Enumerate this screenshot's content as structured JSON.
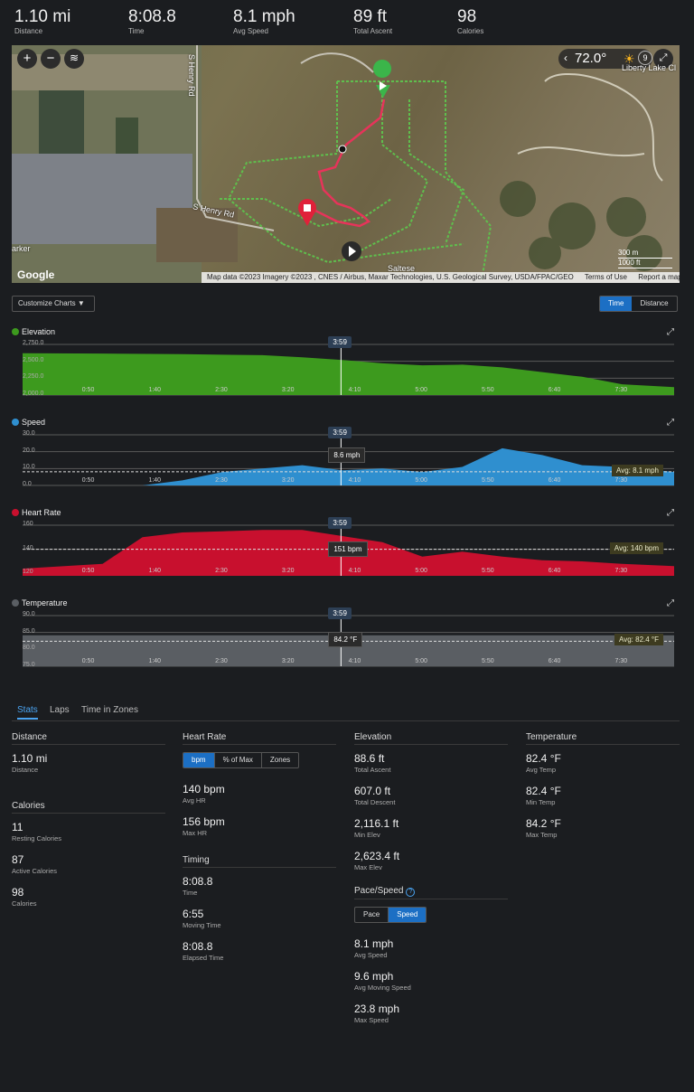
{
  "summary": [
    {
      "value": "1.10 mi",
      "label": "Distance"
    },
    {
      "value": "8:08.8",
      "label": "Time"
    },
    {
      "value": "8.1 mph",
      "label": "Avg Speed"
    },
    {
      "value": "89 ft",
      "label": "Total Ascent"
    },
    {
      "value": "98",
      "label": "Calories"
    }
  ],
  "map": {
    "zoom_in": "+",
    "zoom_out": "−",
    "layers_icon": "layers-icon",
    "weather_temp": "72.0°",
    "wind_speed": "9",
    "labels": [
      "S Henry Rd",
      "S Henry Rd",
      "Liberty Lake Cl",
      "Saltese",
      "arker"
    ],
    "scale_m": "300 m",
    "scale_ft": "1000 ft",
    "google": "Google",
    "attribution": "Map data ©2023 Imagery ©2023 , CNES / Airbus, Maxar Technologies, U.S. Geological Survey, USDA/FPAC/GEO",
    "terms": "Terms of Use",
    "report": "Report a map error"
  },
  "toolbar": {
    "customize": "Customize Charts",
    "toggle": [
      "Time",
      "Distance"
    ],
    "toggle_active": "Time"
  },
  "charts": [
    {
      "name": "Elevation",
      "color": "#3d9a1e",
      "yticks": [
        "2,750.0",
        "2,500.0",
        "2,250.0",
        "2,000.0"
      ],
      "cursor_time": "3:59",
      "cursor_value": "",
      "avg": ""
    },
    {
      "name": "Speed",
      "color": "#2f8fcf",
      "yticks": [
        "30.0",
        "20.0",
        "10.0",
        "0.0"
      ],
      "cursor_time": "3:59",
      "cursor_value": "8.6 mph",
      "avg": "Avg: 8.1 mph"
    },
    {
      "name": "Heart Rate",
      "color": "#c8102e",
      "yticks": [
        "160",
        "140",
        "120"
      ],
      "cursor_time": "3:59",
      "cursor_value": "151 bpm",
      "avg": "Avg: 140 bpm"
    },
    {
      "name": "Temperature",
      "color": "#5a5e63",
      "yticks": [
        "90.0",
        "85.0",
        "80.0",
        "75.0"
      ],
      "cursor_time": "3:59",
      "cursor_value": "84.2 °F",
      "avg": "Avg: 82.4 °F"
    }
  ],
  "xticks": [
    "0:50",
    "1:40",
    "2:30",
    "3:20",
    "4:10",
    "5:00",
    "5:50",
    "6:40",
    "7:30"
  ],
  "chart_data": [
    {
      "type": "area",
      "title": "Elevation",
      "x_unit": "elapsed time (min)",
      "x": [
        0,
        1,
        2,
        3,
        3.5,
        4,
        4.5,
        5,
        5.5,
        6,
        6.5,
        7,
        7.5,
        8.15
      ],
      "values": [
        2620,
        2615,
        2605,
        2590,
        2560,
        2520,
        2470,
        2440,
        2450,
        2410,
        2340,
        2270,
        2160,
        2116
      ],
      "ylim": [
        2000,
        2750
      ]
    },
    {
      "type": "area",
      "title": "Speed",
      "x_unit": "elapsed time (min)",
      "x": [
        0,
        1.5,
        2,
        2.5,
        3,
        3.5,
        4,
        4.5,
        5,
        5.5,
        6,
        6.5,
        7,
        7.5,
        8.15
      ],
      "values": [
        0,
        0,
        3,
        8,
        10,
        12,
        9,
        10,
        8,
        11,
        22,
        18,
        12,
        11,
        8
      ],
      "avg": 8.1,
      "ylim": [
        0,
        30
      ]
    },
    {
      "type": "area",
      "title": "Heart Rate",
      "x_unit": "elapsed time (min)",
      "x": [
        0,
        1,
        1.5,
        2,
        2.5,
        3,
        3.5,
        4,
        4.5,
        5,
        5.5,
        6,
        6.5,
        7,
        7.5,
        8.15
      ],
      "values": [
        124,
        128,
        150,
        154,
        155,
        156,
        156,
        151,
        146,
        134,
        138,
        134,
        131,
        130,
        128,
        126
      ],
      "avg": 140,
      "ylim": [
        118,
        160
      ]
    },
    {
      "type": "area",
      "title": "Temperature",
      "x_unit": "elapsed time (min)",
      "x": [
        0,
        8.15
      ],
      "values": [
        84.2,
        84.2
      ],
      "avg": 82.4,
      "ylim": [
        75,
        90
      ]
    }
  ],
  "tabs": [
    "Stats",
    "Laps",
    "Time in Zones"
  ],
  "stats": {
    "distance": {
      "title": "Distance",
      "value": "1.10 mi",
      "label": "Distance"
    },
    "calories": {
      "title": "Calories",
      "items": [
        {
          "value": "11",
          "label": "Resting Calories"
        },
        {
          "value": "87",
          "label": "Active Calories"
        },
        {
          "value": "98",
          "label": "Calories"
        }
      ]
    },
    "heart_rate": {
      "title": "Heart Rate",
      "segments": [
        "bpm",
        "% of Max",
        "Zones"
      ],
      "items": [
        {
          "value": "140 bpm",
          "label": "Avg HR"
        },
        {
          "value": "156 bpm",
          "label": "Max HR"
        }
      ]
    },
    "timing": {
      "title": "Timing",
      "items": [
        {
          "value": "8:08.8",
          "label": "Time"
        },
        {
          "value": "6:55",
          "label": "Moving Time"
        },
        {
          "value": "8:08.8",
          "label": "Elapsed Time"
        }
      ]
    },
    "elevation": {
      "title": "Elevation",
      "items": [
        {
          "value": "88.6 ft",
          "label": "Total Ascent"
        },
        {
          "value": "607.0 ft",
          "label": "Total Descent"
        },
        {
          "value": "2,116.1 ft",
          "label": "Min Elev"
        },
        {
          "value": "2,623.4 ft",
          "label": "Max Elev"
        }
      ]
    },
    "pace_speed": {
      "title": "Pace/Speed",
      "segments": [
        "Pace",
        "Speed"
      ],
      "items": [
        {
          "value": "8.1 mph",
          "label": "Avg Speed"
        },
        {
          "value": "9.6 mph",
          "label": "Avg Moving Speed"
        },
        {
          "value": "23.8 mph",
          "label": "Max Speed"
        }
      ]
    },
    "temperature": {
      "title": "Temperature",
      "items": [
        {
          "value": "82.4 °F",
          "label": "Avg Temp"
        },
        {
          "value": "82.4 °F",
          "label": "Min Temp"
        },
        {
          "value": "84.2 °F",
          "label": "Max Temp"
        }
      ]
    }
  }
}
